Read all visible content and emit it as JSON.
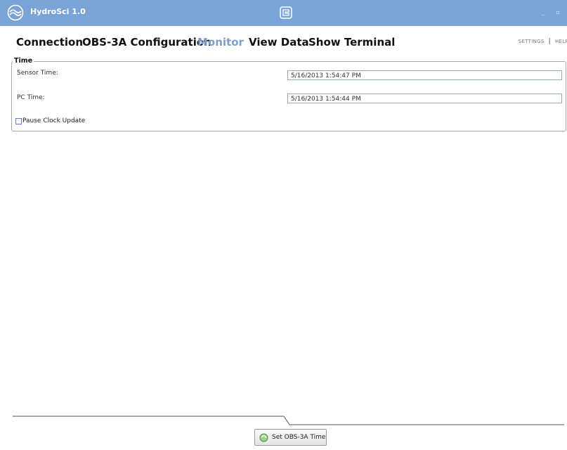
{
  "app": {
    "title": "HydroSci 1.0",
    "window_controls": "_ ▫ ×"
  },
  "nav": {
    "items": [
      {
        "label": "Connection",
        "active": false
      },
      {
        "label": "OBS-3A Configuration",
        "active": false
      },
      {
        "label": "Monitor",
        "active": true
      },
      {
        "label": "View Data",
        "active": false
      },
      {
        "label": "Show Terminal",
        "active": false
      }
    ],
    "settings_label": "SETTINGS",
    "separator": "|",
    "help_label": "HELP"
  },
  "time_group": {
    "legend": "Time",
    "sensor_time_label": "Sensor Time:",
    "sensor_time_value": "5/16/2013 1:54:47 PM",
    "pc_time_label": "PC Time:",
    "pc_time_value": "5/16/2013 1:54:44 PM",
    "pause_label": "Pause Clock Update",
    "pause_checked": false
  },
  "actions": {
    "set_time_label": "Set OBS-3A Time"
  },
  "colors": {
    "titlebar": "#7aa3d6",
    "active_nav": "#7d9fc9"
  },
  "icons": {
    "app": "wave-logo-icon",
    "center": "campbell-logo-icon",
    "set_time": "clock-sync-icon"
  }
}
